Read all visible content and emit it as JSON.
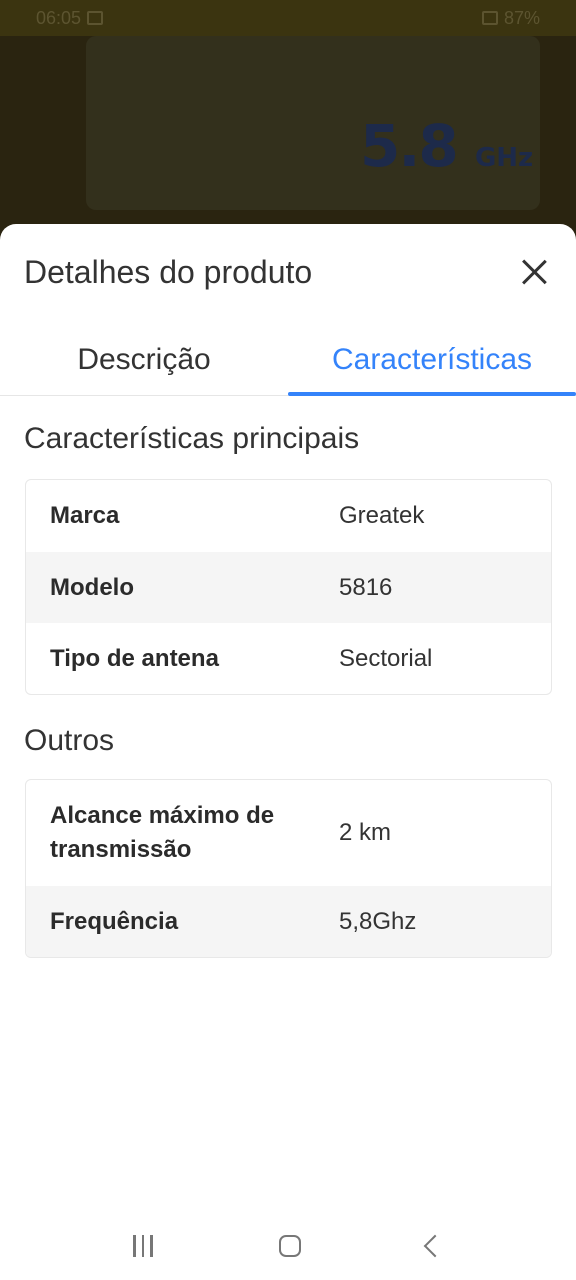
{
  "status_bar": {
    "time": "06:05",
    "battery": "87%"
  },
  "background": {
    "product_label": "5.8",
    "product_unit": "GHz"
  },
  "sheet": {
    "title": "Detalhes do produto",
    "tabs": [
      {
        "label": "Descrição",
        "active": false
      },
      {
        "label": "Características",
        "active": true
      }
    ],
    "sections": [
      {
        "title": "Características principais",
        "rows": [
          {
            "key": "Marca",
            "value": "Greatek"
          },
          {
            "key": "Modelo",
            "value": "5816"
          },
          {
            "key": "Tipo de antena",
            "value": "Sectorial"
          }
        ]
      },
      {
        "title": "Outros",
        "rows": [
          {
            "key": "Alcance máximo de transmissão",
            "value": "2 km"
          },
          {
            "key": "Frequência",
            "value": "5,8Ghz"
          }
        ]
      }
    ]
  },
  "colors": {
    "accent": "#3483fa",
    "row_alt": "#f5f5f5"
  },
  "icons": {
    "close": "close-icon",
    "nav_recent": "recent-apps-icon",
    "nav_home": "home-icon",
    "nav_back": "back-icon"
  }
}
